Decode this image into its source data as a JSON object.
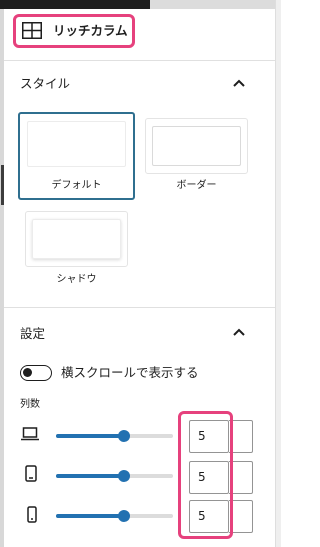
{
  "block": {
    "icon": "columns-icon",
    "title": "リッチカラム"
  },
  "style_section": {
    "title": "スタイル",
    "expanded": true,
    "options": [
      {
        "label": "デフォルト",
        "selected": true
      },
      {
        "label": "ボーダー",
        "selected": false
      },
      {
        "label": "シャドウ",
        "selected": false
      }
    ]
  },
  "settings_section": {
    "title": "設定",
    "expanded": true,
    "horizontal_scroll": {
      "label": "横スクロールで表示する",
      "enabled": false
    },
    "columns": {
      "label": "列数",
      "rows": [
        {
          "device": "laptop-icon",
          "value": "5",
          "slider_fraction": 0.58
        },
        {
          "device": "tablet-icon",
          "value": "5",
          "slider_fraction": 0.58
        },
        {
          "device": "mobile-icon",
          "value": "5",
          "slider_fraction": 0.58
        }
      ]
    }
  },
  "colors": {
    "accent": "#2271b1",
    "highlight": "#e6417d",
    "selected_border": "#2f6f8f"
  }
}
